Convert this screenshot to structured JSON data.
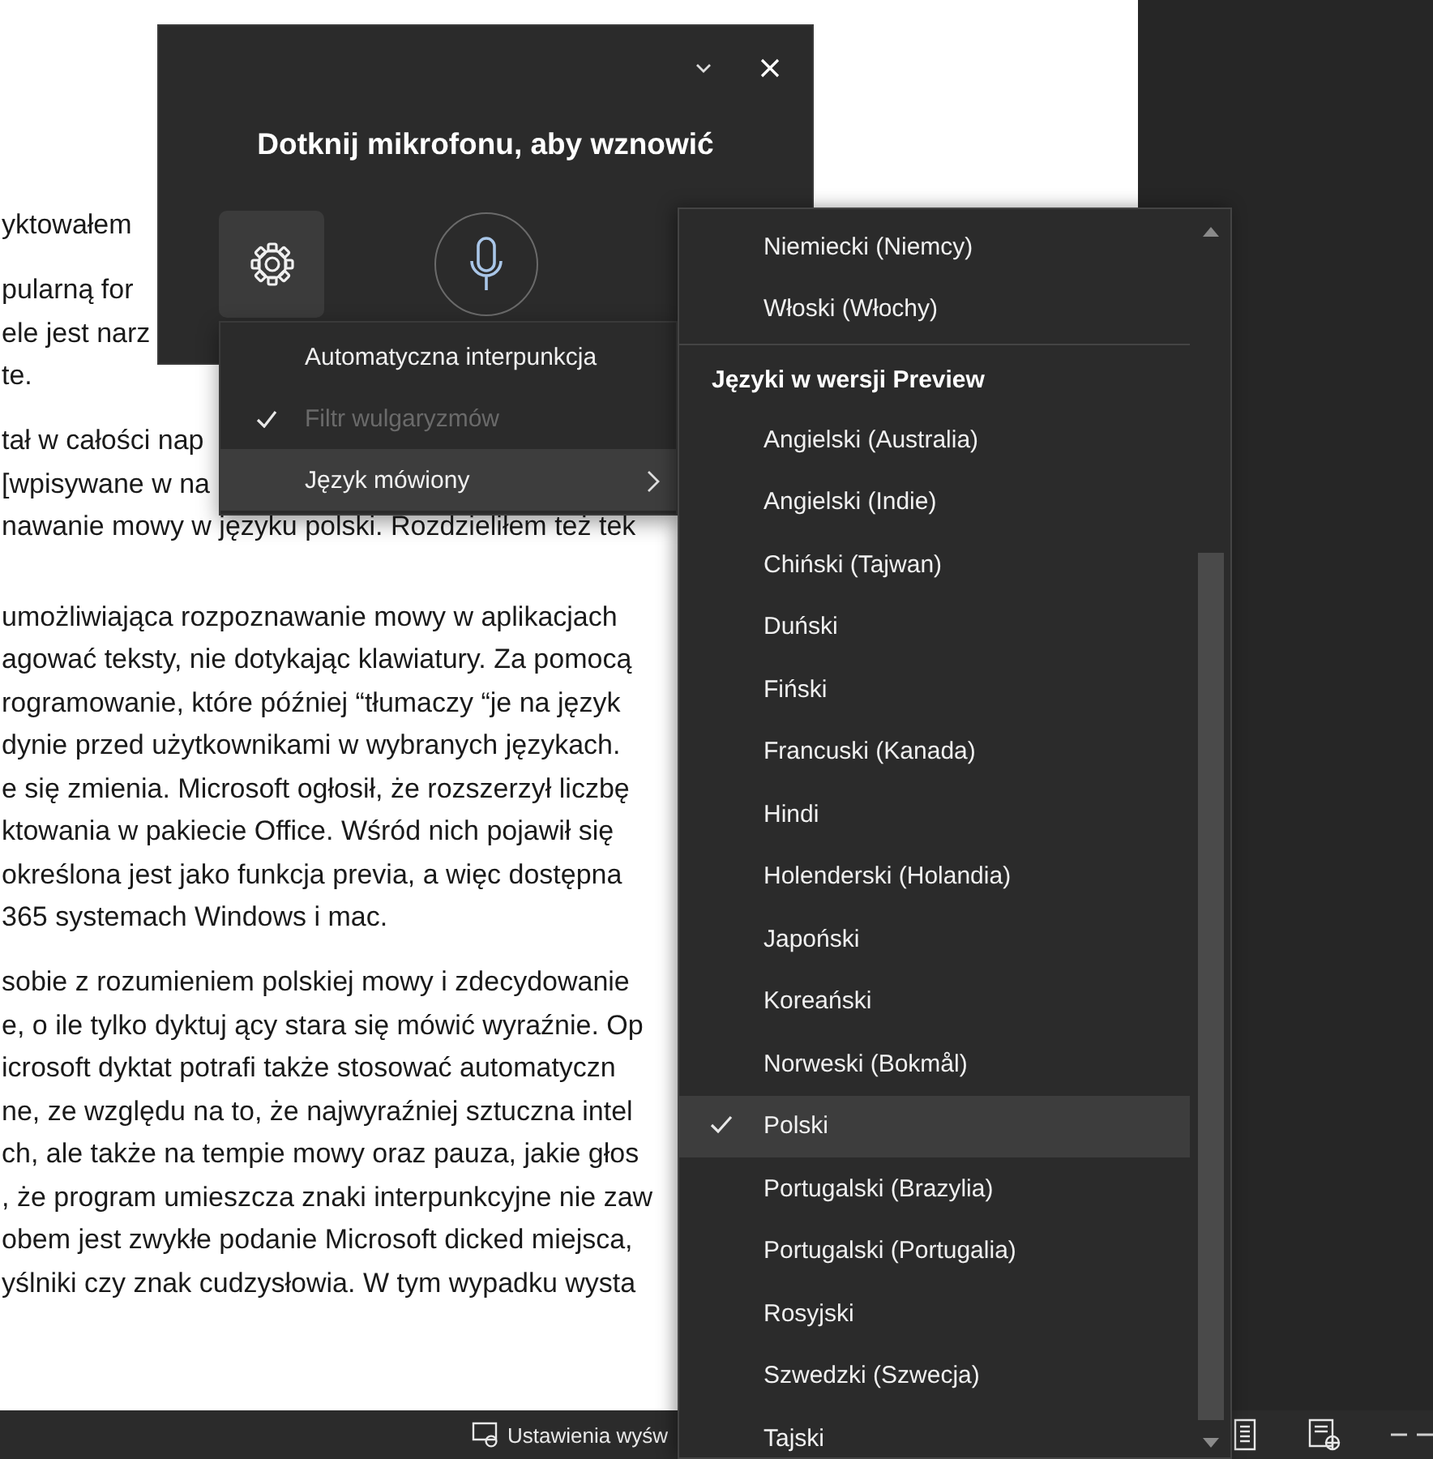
{
  "document": {
    "paragraphs": [
      [
        "yktowałem"
      ],
      [
        "pularną for",
        "ele jest narz",
        "te."
      ],
      [
        "tał w całości nap",
        "[wpisywane w na",
        "nawanie mowy w języku polski. Rozdzieliłem też tek"
      ],
      [
        "umożliwiająca rozpoznawanie mowy w aplikacjach",
        "agować teksty, nie dotykając klawiatury. Za pomocą",
        "rogramowanie, które później “tłumaczy “je na język",
        "dynie przed użytkownikami w wybranych językach.",
        "e się zmienia. Microsoft ogłosił, że rozszerzył liczbę",
        "ktowania w pakiecie Office. Wśród nich pojawił się",
        "określona jest jako funkcja previa, a więc dostępna",
        "365 systemach Windows i mac."
      ],
      [
        "sobie z rozumieniem polskiej mowy i zdecydowanie",
        "e, o ile tylko dyktuj ący stara się mówić wyraźnie. Op",
        "icrosoft dyktat potrafi także stosować automatyczn",
        "ne, ze względu na to, że najwyraźniej sztuczna intel",
        "ch, ale także na tempie mowy oraz pauza, jakie głos",
        ", że program umieszcza znaki interpunkcyjne nie zaw",
        "obem jest zwykłe podanie Microsoft dicked miejsca,",
        "yślniki czy znak cudzysłowia. W tym wypadku wysta"
      ]
    ]
  },
  "dictation": {
    "title": "Dotknij mikrofonu, aby wznowić"
  },
  "settings_menu": {
    "items": [
      {
        "label": "Automatyczna interpunkcja",
        "kind": "toggle",
        "checked": false,
        "disabled": false,
        "selected": false
      },
      {
        "label": "Filtr wulgaryzmów",
        "kind": "toggle",
        "checked": true,
        "disabled": true,
        "selected": false
      },
      {
        "label": "Język mówiony",
        "kind": "submenu",
        "checked": false,
        "disabled": false,
        "selected": true
      }
    ]
  },
  "language_menu": {
    "groups": [
      {
        "items": [
          {
            "label": "Niemiecki (Niemcy)",
            "selected": false
          },
          {
            "label": "Włoski (Włochy)",
            "selected": false
          }
        ]
      },
      {
        "header": "Języki w wersji Preview",
        "items": [
          {
            "label": "Angielski (Australia)",
            "selected": false
          },
          {
            "label": "Angielski (Indie)",
            "selected": false
          },
          {
            "label": "Chiński (Tajwan)",
            "selected": false
          },
          {
            "label": "Duński",
            "selected": false
          },
          {
            "label": "Fiński",
            "selected": false
          },
          {
            "label": "Francuski (Kanada)",
            "selected": false
          },
          {
            "label": "Hindi",
            "selected": false
          },
          {
            "label": "Holenderski (Holandia)",
            "selected": false
          },
          {
            "label": "Japoński",
            "selected": false
          },
          {
            "label": "Koreański",
            "selected": false
          },
          {
            "label": "Norweski (Bokmål)",
            "selected": false
          },
          {
            "label": "Polski",
            "selected": true
          },
          {
            "label": "Portugalski (Brazylia)",
            "selected": false
          },
          {
            "label": "Portugalski (Portugalia)",
            "selected": false
          },
          {
            "label": "Rosyjski",
            "selected": false
          },
          {
            "label": "Szwedzki (Szwecja)",
            "selected": false
          },
          {
            "label": "Tajski",
            "selected": false
          }
        ]
      }
    ]
  },
  "status_bar": {
    "display_settings": "Ustawienia wyśw"
  }
}
